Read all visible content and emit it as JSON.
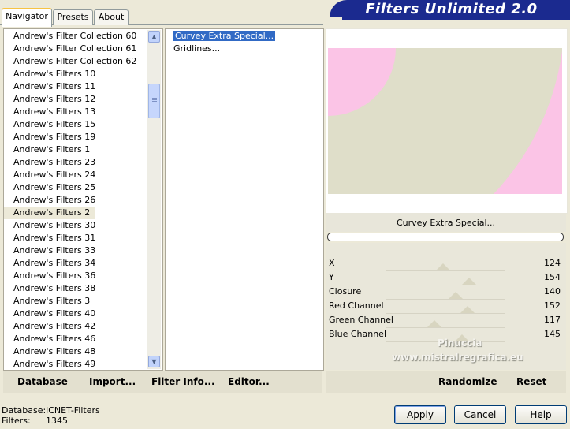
{
  "window": {
    "banner_title": "Filters Unlimited 2.0"
  },
  "tabs": [
    {
      "label": "Navigator",
      "active": true
    },
    {
      "label": "Presets",
      "active": false
    },
    {
      "label": "About",
      "active": false
    }
  ],
  "categories": {
    "items": [
      "Andrew's Filter Collection 60",
      "Andrew's Filter Collection 61",
      "Andrew's Filter Collection 62",
      "Andrew's Filters 10",
      "Andrew's Filters 11",
      "Andrew's Filters 12",
      "Andrew's Filters 13",
      "Andrew's Filters 15",
      "Andrew's Filters 19",
      "Andrew's Filters 1",
      "Andrew's Filters 23",
      "Andrew's Filters 24",
      "Andrew's Filters 25",
      "Andrew's Filters 26",
      "Andrew's Filters 2",
      "Andrew's Filters 30",
      "Andrew's Filters 31",
      "Andrew's Filters 33",
      "Andrew's Filters 34",
      "Andrew's Filters 36",
      "Andrew's Filters 38",
      "Andrew's Filters 3",
      "Andrew's Filters 40",
      "Andrew's Filters 42",
      "Andrew's Filters 46",
      "Andrew's Filters 48",
      "Andrew's Filters 49"
    ],
    "highlighted": "Andrew's Filters 2"
  },
  "filters": {
    "items": [
      "Curvey Extra Special...",
      "Gridlines..."
    ],
    "selected": "Curvey Extra Special..."
  },
  "preview": {
    "filter_name": "Curvey Extra Special...",
    "colors": {
      "background": "#dfdec9",
      "shape": "#fbc4e6"
    }
  },
  "parameters": [
    {
      "name": "X",
      "value": 124
    },
    {
      "name": "Y",
      "value": 154
    },
    {
      "name": "Closure",
      "value": 140
    },
    {
      "name": "Red Channel",
      "value": 152
    },
    {
      "name": "Green Channel",
      "value": 117
    },
    {
      "name": "Blue Channel",
      "value": 145
    }
  ],
  "watermark": {
    "line1": "Pinuccia",
    "line2": "www.mistralregrafica.eu"
  },
  "bottom_left_buttons": {
    "database": "Database",
    "import": "Import...",
    "filter_info": "Filter Info...",
    "editor": "Editor..."
  },
  "bottom_right_buttons": {
    "randomize": "Randomize",
    "reset": "Reset"
  },
  "status": {
    "database_label": "Database:",
    "database_value": "ICNET-Filters",
    "filters_label": "Filters:",
    "filters_value": "1345"
  },
  "dialog_buttons": {
    "apply": "Apply",
    "cancel": "Cancel",
    "help": "Help"
  },
  "scrollbar": {
    "up_icon": "▲",
    "down_icon": "▼"
  }
}
